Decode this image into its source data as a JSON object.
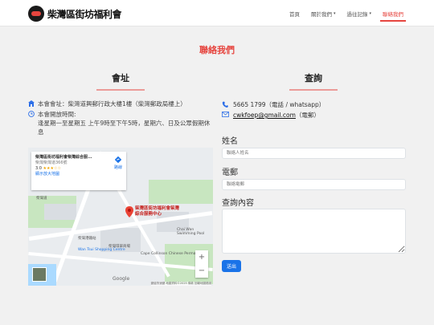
{
  "brand": {
    "name": "柴灣區街坊福利會"
  },
  "nav": {
    "items": [
      {
        "label": "首頁",
        "caret": ""
      },
      {
        "label": "關於我們",
        "caret": "▾"
      },
      {
        "label": "過往記錄",
        "caret": "▾"
      },
      {
        "label": "聯絡我們",
        "caret": ""
      }
    ],
    "active": "聯絡我們"
  },
  "page_title": "聯絡我們",
  "left": {
    "heading": "會址",
    "address": "本會會址：柴灣道興郵行政大樓1樓（柴灣郵政局樓上）",
    "hours": "本會開放時間:\n逢星期一至星期五 上午9時至下午5時，星期六、日及公眾假期休息"
  },
  "map": {
    "card_title": "柴灣區街坊福利會柴灣綜合服...",
    "card_sub": "柴灣柴灣道366號",
    "rating": "3.0",
    "stars": "★★★☆☆",
    "card_link": "顯示放大地圖",
    "directions": "路線",
    "pin_label": "柴灣區街坊福利會柴灣綜合服務中心",
    "labels": [
      "Wan Tsui Shopping Centre",
      "柴灣港鐵站",
      "柴灣道",
      "Cape Collinson Chinese Permanent",
      "柴灣環翠商場",
      "Chai Wan Swimming Pool"
    ],
    "google": "Google",
    "footer": "鍵盤快速鍵 地圖資料©2025 條款 回報地圖錯誤"
  },
  "right": {
    "heading": "查詢",
    "phone": "5665 1799（電話 / whatsapp）",
    "email": "cwkfoep@gmail.com",
    "email_suffix": "（電郵）",
    "form": {
      "name_label": "姓名",
      "name_placeholder": "聯絡人姓名",
      "tel_label": "電郵",
      "tel_placeholder": "聯絡電郵",
      "msg_label": "查詢內容",
      "msg_placeholder": "",
      "submit": "送出"
    }
  },
  "colors": {
    "accent": "#e6453f",
    "primary": "#1a73e8"
  }
}
